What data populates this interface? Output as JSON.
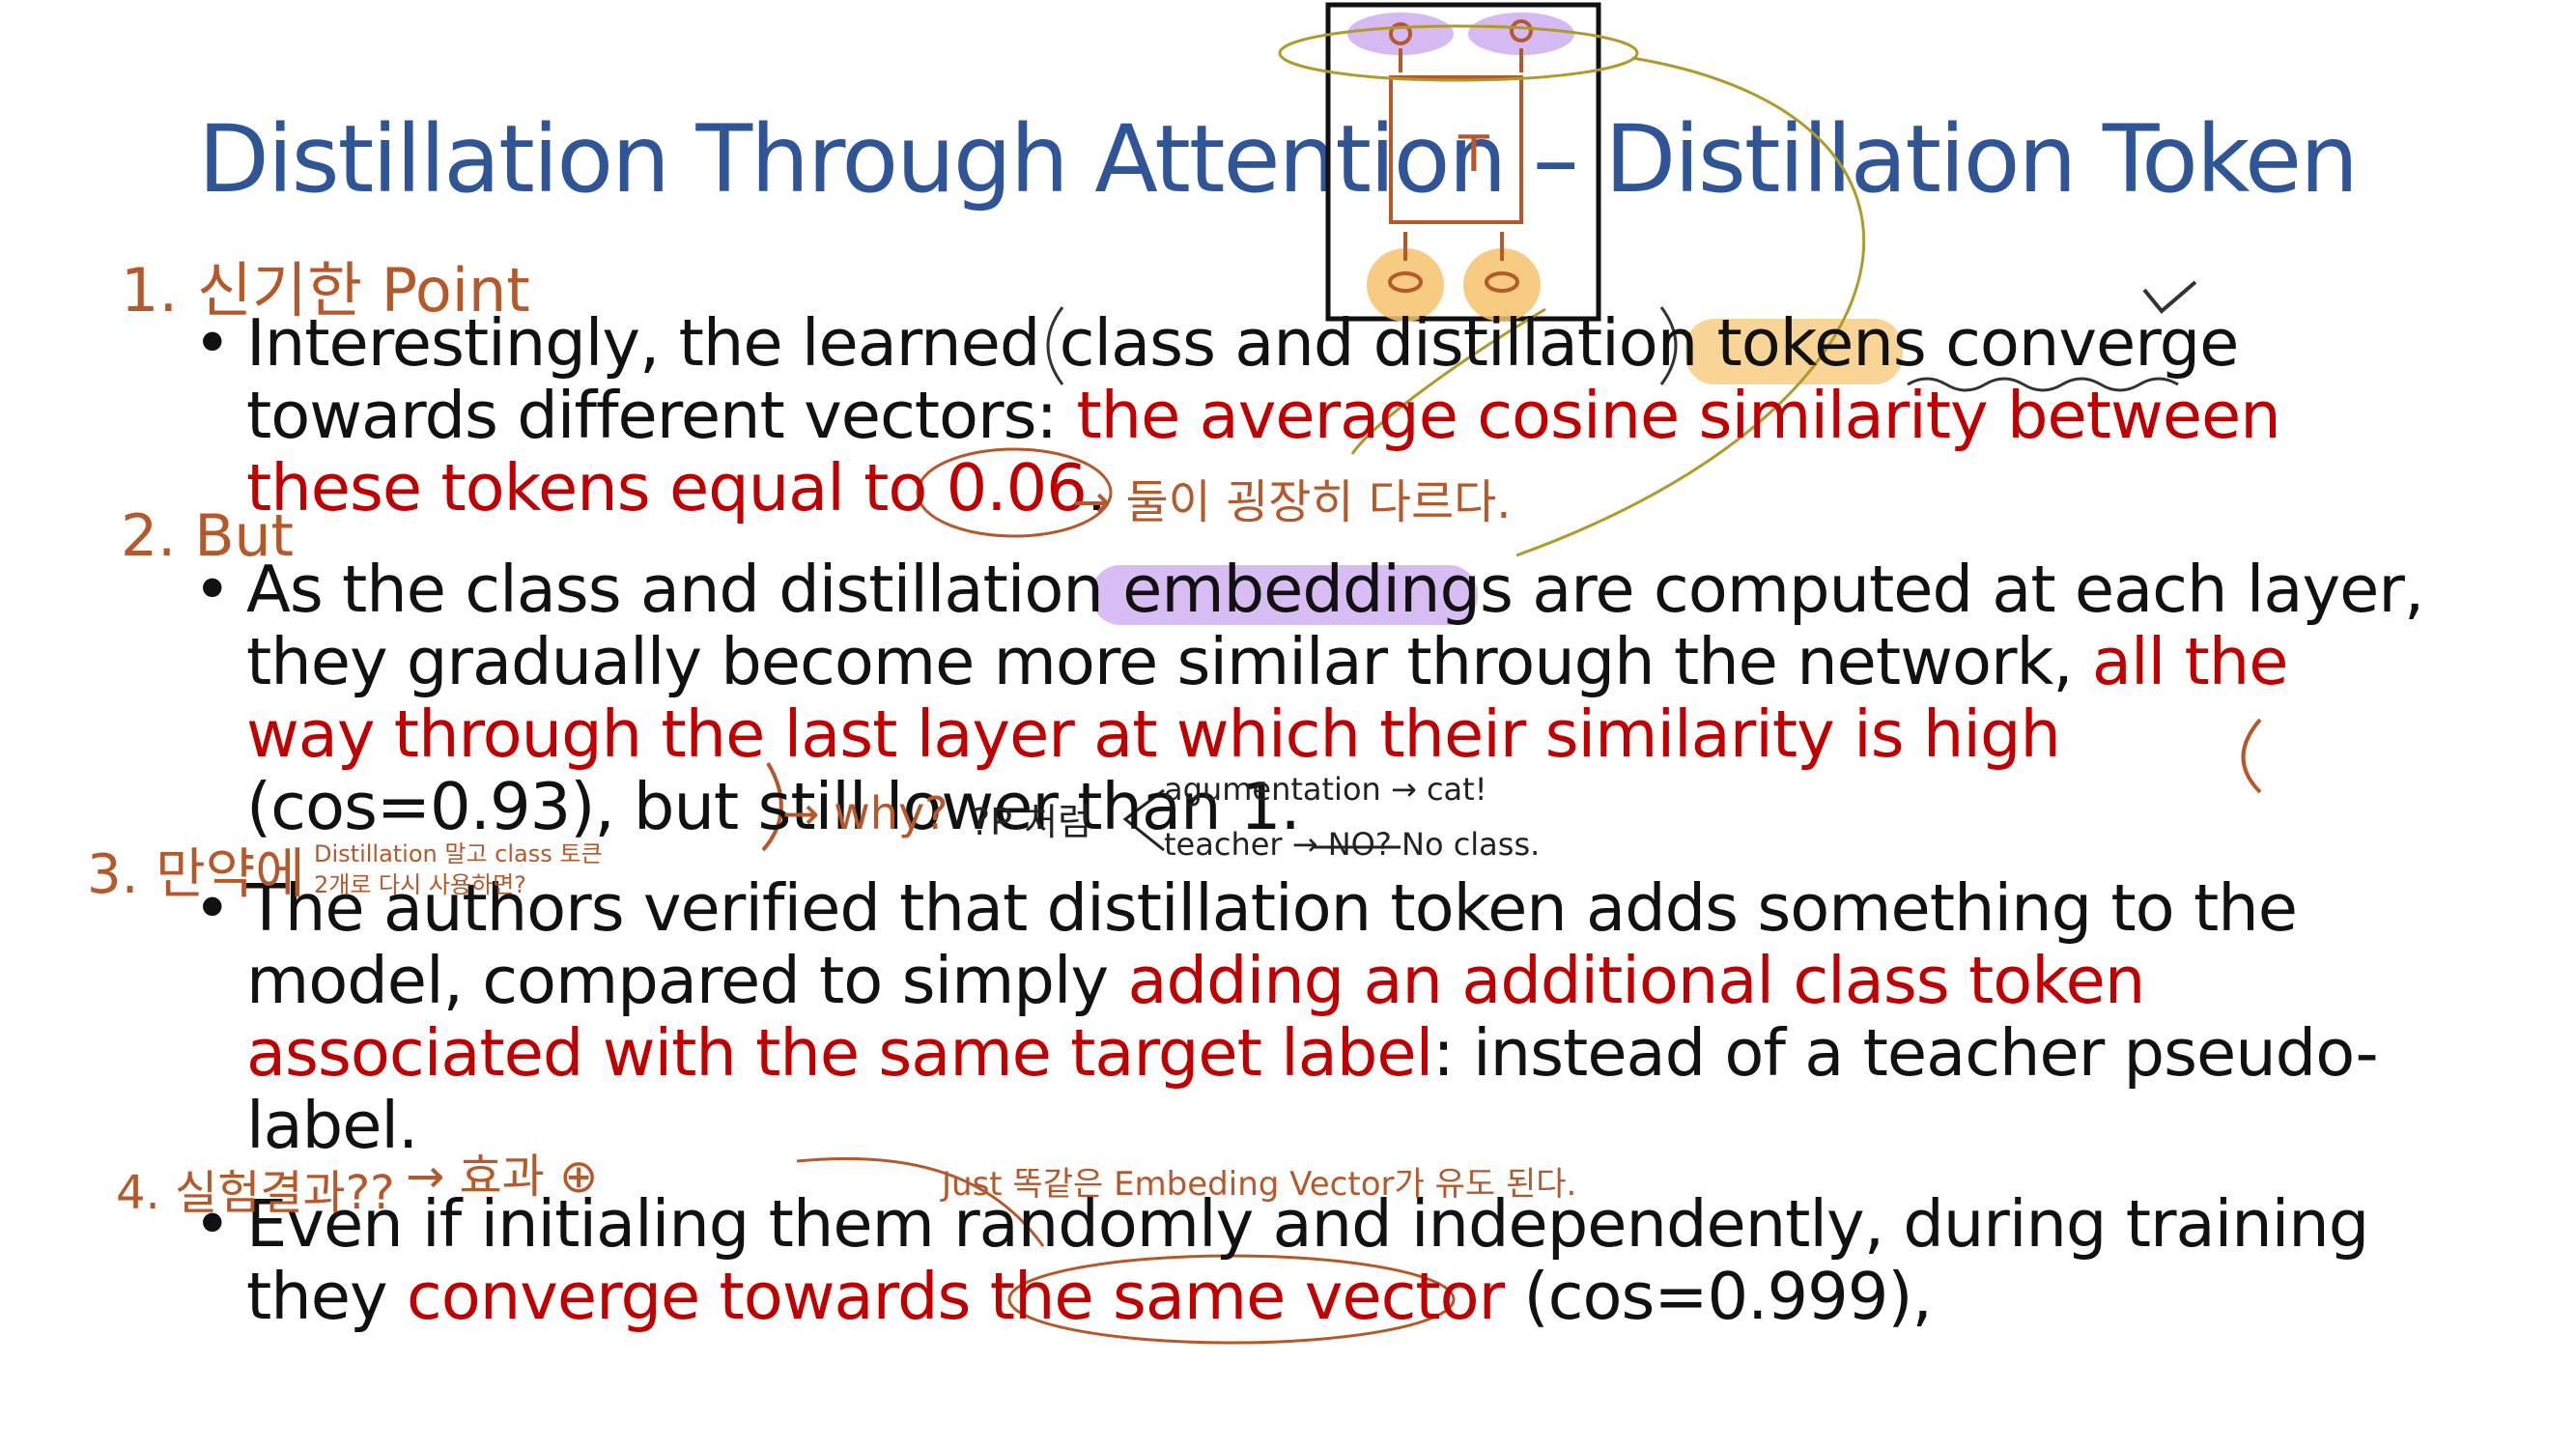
{
  "title": "Distillation Through Attention – Distillation Token",
  "bullets": [
    {
      "segments": [
        {
          "text": "Interestingly, the learned class and distillation tokens converge towards different vectors: ",
          "emphasis": false
        },
        {
          "text": "the average cosine similarity between these tokens equal to 0.06",
          "emphasis": true
        },
        {
          "text": ".",
          "emphasis": false
        }
      ]
    },
    {
      "segments": [
        {
          "text": "As the class and distillation embeddings are computed at each layer, they gradually become more similar through the network, ",
          "emphasis": false
        },
        {
          "text": "all the way through the last layer at which their similarity is high",
          "emphasis": true
        },
        {
          "text": " (cos=0.93), but still lower than 1.",
          "emphasis": false
        }
      ]
    },
    {
      "segments": [
        {
          "text": "The authors verified that distillation token adds something to the model, compared to simply ",
          "emphasis": false
        },
        {
          "text": "adding an additional class token associated with the same target label",
          "emphasis": true
        },
        {
          "text": ": instead of a teacher pseudo-label.",
          "emphasis": false
        }
      ]
    },
    {
      "segments": [
        {
          "text": "Even if initialing them randomly and independently, during training they ",
          "emphasis": false
        },
        {
          "text": "converge towards the same vector",
          "emphasis": true
        },
        {
          "text": " (cos=0.999),",
          "emphasis": false
        }
      ]
    }
  ],
  "annotations": {
    "note1": "1. 신기한 Point",
    "note2": "2. But",
    "note3": "3. 만약에",
    "note3_detail": "Distillation 말고 class 토큰 2개로 다시 사용하면?",
    "note4": "4. 실험결과??",
    "note4_result": "→ 효과 ⊕",
    "arrow_different": "→ 둘이 굉장히 다르다.",
    "why": "→ why?",
    "gap_like": "?P 처럼",
    "augmentation": "agumentation → cat!",
    "teacher": "teacher → NO? No class.",
    "same_vector": "Just 똑같은 Embeding Vector가 유도 된다.",
    "diagram_label": "T",
    "check_mark": "✓"
  },
  "colors": {
    "title": "#2f5597",
    "emphasis": "#c00000",
    "body": "#111111",
    "ink_annotation": "#b5582a",
    "highlight_orange": "#f6c26b",
    "highlight_purple": "#c9a7f0",
    "olive_ink": "#b09a2a"
  }
}
